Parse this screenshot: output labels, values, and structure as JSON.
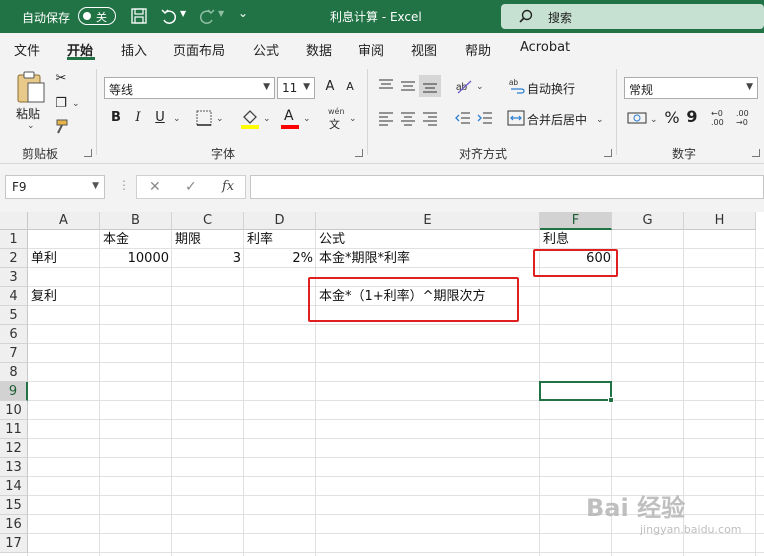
{
  "titlebar": {
    "autosave_label": "自动保存",
    "autosave_state": "关",
    "document_title": "利息计算  -  Excel",
    "search_placeholder": "搜索",
    "background_color": "#217346"
  },
  "menu": {
    "tabs": [
      "文件",
      "开始",
      "插入",
      "页面布局",
      "公式",
      "数据",
      "审阅",
      "视图",
      "帮助",
      "Acrobat"
    ],
    "active_tab": "开始"
  },
  "ribbon": {
    "clipboard": {
      "paste_label": "粘贴",
      "group_label": "剪贴板"
    },
    "font": {
      "font_name": "等线",
      "font_size": "11",
      "group_label": "字体",
      "bold": "B",
      "italic": "I",
      "underline": "U",
      "grow": "A",
      "shrink": "A",
      "phonetic_top": "wén",
      "phonetic_bottom": "文",
      "fill_color": "#ffff00",
      "font_color": "#ff0000"
    },
    "alignment": {
      "wrap_text_label": "自动换行",
      "merge_label": "合并后居中",
      "group_label": "对齐方式"
    },
    "number": {
      "format": "常规",
      "percent": "%",
      "comma": "9",
      "group_label": "数字",
      "inc_decimal_top": "←0",
      "inc_decimal_bottom": ".00",
      "dec_decimal_top": ".00",
      "dec_decimal_bottom": "→0"
    }
  },
  "formula_bar": {
    "name_box": "F9",
    "formula": "",
    "fx_label": "fx"
  },
  "sheet": {
    "columns": [
      "A",
      "B",
      "C",
      "D",
      "E",
      "F",
      "G",
      "H"
    ],
    "rows": [
      "1",
      "2",
      "3",
      "4",
      "5",
      "6",
      "7",
      "8",
      "9",
      "10",
      "11",
      "12",
      "13",
      "14",
      "15",
      "16",
      "17"
    ],
    "selected_column": "F",
    "selected_row": "9",
    "cells": {
      "B1": "本金",
      "C1": "期限",
      "D1": "利率",
      "E1": "公式",
      "F1": "利息",
      "A2": "单利",
      "B2": "10000",
      "C2": "3",
      "D2": "2%",
      "E2": "本金*期限*利率",
      "F2": "600",
      "A4": "复利",
      "E4": "本金*（1+利率）^期限次方"
    },
    "annotation_color": "#e02020",
    "selection_color": "#217346"
  },
  "watermark": {
    "text": "Bai 经验",
    "subtext": "jingyan.baidu.com"
  }
}
